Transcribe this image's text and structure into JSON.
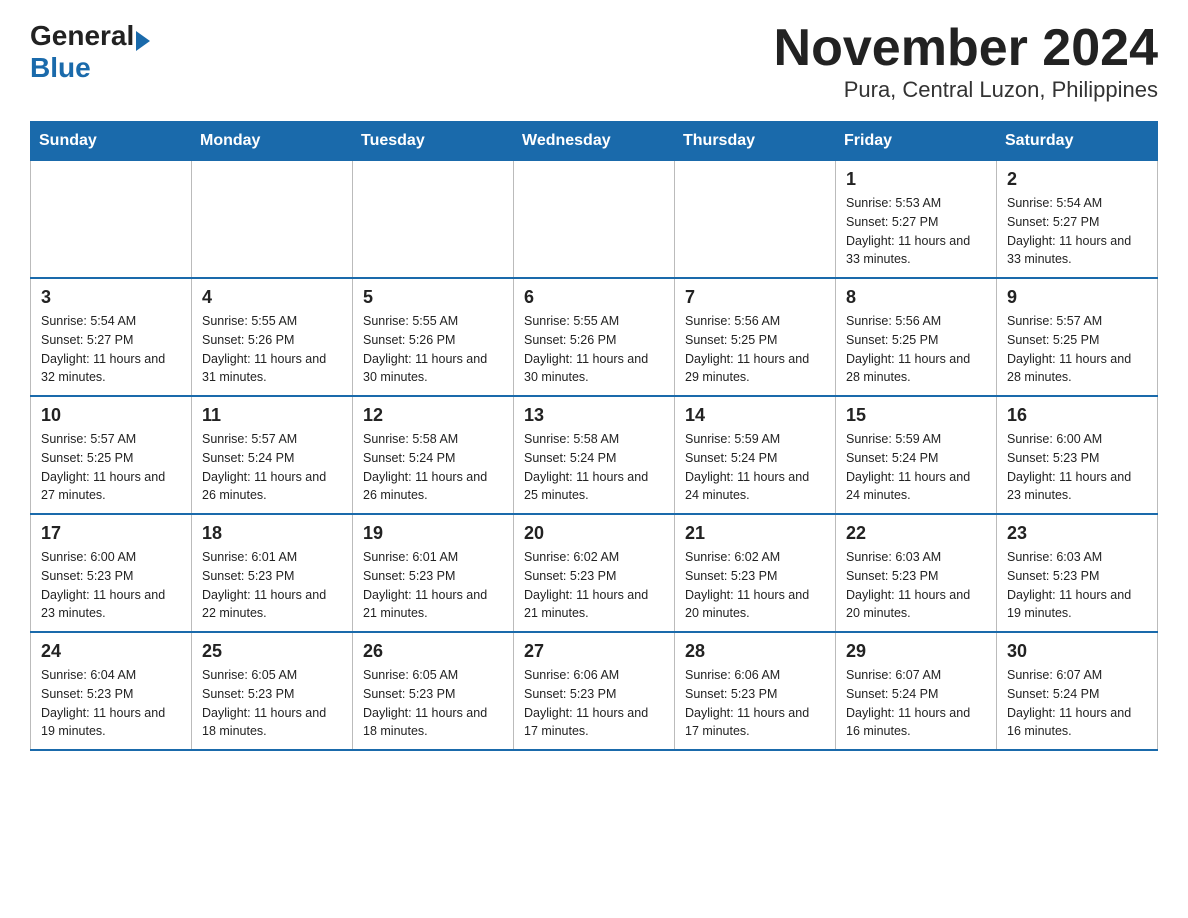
{
  "logo": {
    "general_text": "General",
    "blue_text": "Blue"
  },
  "title": "November 2024",
  "subtitle": "Pura, Central Luzon, Philippines",
  "calendar": {
    "headers": [
      "Sunday",
      "Monday",
      "Tuesday",
      "Wednesday",
      "Thursday",
      "Friday",
      "Saturday"
    ],
    "weeks": [
      [
        {
          "day": "",
          "info": ""
        },
        {
          "day": "",
          "info": ""
        },
        {
          "day": "",
          "info": ""
        },
        {
          "day": "",
          "info": ""
        },
        {
          "day": "",
          "info": ""
        },
        {
          "day": "1",
          "info": "Sunrise: 5:53 AM\nSunset: 5:27 PM\nDaylight: 11 hours and 33 minutes."
        },
        {
          "day": "2",
          "info": "Sunrise: 5:54 AM\nSunset: 5:27 PM\nDaylight: 11 hours and 33 minutes."
        }
      ],
      [
        {
          "day": "3",
          "info": "Sunrise: 5:54 AM\nSunset: 5:27 PM\nDaylight: 11 hours and 32 minutes."
        },
        {
          "day": "4",
          "info": "Sunrise: 5:55 AM\nSunset: 5:26 PM\nDaylight: 11 hours and 31 minutes."
        },
        {
          "day": "5",
          "info": "Sunrise: 5:55 AM\nSunset: 5:26 PM\nDaylight: 11 hours and 30 minutes."
        },
        {
          "day": "6",
          "info": "Sunrise: 5:55 AM\nSunset: 5:26 PM\nDaylight: 11 hours and 30 minutes."
        },
        {
          "day": "7",
          "info": "Sunrise: 5:56 AM\nSunset: 5:25 PM\nDaylight: 11 hours and 29 minutes."
        },
        {
          "day": "8",
          "info": "Sunrise: 5:56 AM\nSunset: 5:25 PM\nDaylight: 11 hours and 28 minutes."
        },
        {
          "day": "9",
          "info": "Sunrise: 5:57 AM\nSunset: 5:25 PM\nDaylight: 11 hours and 28 minutes."
        }
      ],
      [
        {
          "day": "10",
          "info": "Sunrise: 5:57 AM\nSunset: 5:25 PM\nDaylight: 11 hours and 27 minutes."
        },
        {
          "day": "11",
          "info": "Sunrise: 5:57 AM\nSunset: 5:24 PM\nDaylight: 11 hours and 26 minutes."
        },
        {
          "day": "12",
          "info": "Sunrise: 5:58 AM\nSunset: 5:24 PM\nDaylight: 11 hours and 26 minutes."
        },
        {
          "day": "13",
          "info": "Sunrise: 5:58 AM\nSunset: 5:24 PM\nDaylight: 11 hours and 25 minutes."
        },
        {
          "day": "14",
          "info": "Sunrise: 5:59 AM\nSunset: 5:24 PM\nDaylight: 11 hours and 24 minutes."
        },
        {
          "day": "15",
          "info": "Sunrise: 5:59 AM\nSunset: 5:24 PM\nDaylight: 11 hours and 24 minutes."
        },
        {
          "day": "16",
          "info": "Sunrise: 6:00 AM\nSunset: 5:23 PM\nDaylight: 11 hours and 23 minutes."
        }
      ],
      [
        {
          "day": "17",
          "info": "Sunrise: 6:00 AM\nSunset: 5:23 PM\nDaylight: 11 hours and 23 minutes."
        },
        {
          "day": "18",
          "info": "Sunrise: 6:01 AM\nSunset: 5:23 PM\nDaylight: 11 hours and 22 minutes."
        },
        {
          "day": "19",
          "info": "Sunrise: 6:01 AM\nSunset: 5:23 PM\nDaylight: 11 hours and 21 minutes."
        },
        {
          "day": "20",
          "info": "Sunrise: 6:02 AM\nSunset: 5:23 PM\nDaylight: 11 hours and 21 minutes."
        },
        {
          "day": "21",
          "info": "Sunrise: 6:02 AM\nSunset: 5:23 PM\nDaylight: 11 hours and 20 minutes."
        },
        {
          "day": "22",
          "info": "Sunrise: 6:03 AM\nSunset: 5:23 PM\nDaylight: 11 hours and 20 minutes."
        },
        {
          "day": "23",
          "info": "Sunrise: 6:03 AM\nSunset: 5:23 PM\nDaylight: 11 hours and 19 minutes."
        }
      ],
      [
        {
          "day": "24",
          "info": "Sunrise: 6:04 AM\nSunset: 5:23 PM\nDaylight: 11 hours and 19 minutes."
        },
        {
          "day": "25",
          "info": "Sunrise: 6:05 AM\nSunset: 5:23 PM\nDaylight: 11 hours and 18 minutes."
        },
        {
          "day": "26",
          "info": "Sunrise: 6:05 AM\nSunset: 5:23 PM\nDaylight: 11 hours and 18 minutes."
        },
        {
          "day": "27",
          "info": "Sunrise: 6:06 AM\nSunset: 5:23 PM\nDaylight: 11 hours and 17 minutes."
        },
        {
          "day": "28",
          "info": "Sunrise: 6:06 AM\nSunset: 5:23 PM\nDaylight: 11 hours and 17 minutes."
        },
        {
          "day": "29",
          "info": "Sunrise: 6:07 AM\nSunset: 5:24 PM\nDaylight: 11 hours and 16 minutes."
        },
        {
          "day": "30",
          "info": "Sunrise: 6:07 AM\nSunset: 5:24 PM\nDaylight: 11 hours and 16 minutes."
        }
      ]
    ]
  }
}
